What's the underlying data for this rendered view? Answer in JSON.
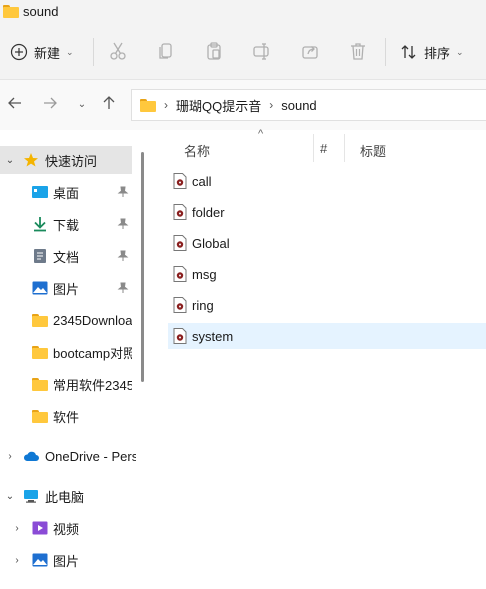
{
  "window": {
    "title": "sound"
  },
  "toolbar": {
    "new_label": "新建",
    "sort_label": "排序",
    "icons": [
      "cut-icon",
      "copy-icon",
      "paste-icon",
      "rename-icon",
      "share-icon",
      "delete-icon"
    ]
  },
  "address": {
    "crumbs": [
      "珊瑚QQ提示音",
      "sound"
    ]
  },
  "nav": {
    "quick_access": "快速访问",
    "items": [
      {
        "label": "桌面",
        "icon": "desktop-icon",
        "pinned": true
      },
      {
        "label": "下载",
        "icon": "download-icon",
        "pinned": true
      },
      {
        "label": "文档",
        "icon": "document-icon",
        "pinned": true
      },
      {
        "label": "图片",
        "icon": "pictures-icon",
        "pinned": true
      },
      {
        "label": "2345Downloa",
        "icon": "folder-icon",
        "pinned": false
      },
      {
        "label": "bootcamp对照",
        "icon": "folder-icon",
        "pinned": false
      },
      {
        "label": "常用软件2345",
        "icon": "folder-icon",
        "pinned": false
      },
      {
        "label": "软件",
        "icon": "folder-icon",
        "pinned": false
      }
    ],
    "onedrive": "OneDrive - Pers",
    "this_pc": "此电脑",
    "pc_items": [
      {
        "label": "视频",
        "icon": "video-icon"
      },
      {
        "label": "图片",
        "icon": "pictures-icon"
      }
    ]
  },
  "columns": {
    "name": "名称",
    "number": "#",
    "title": "标题"
  },
  "files": [
    {
      "name": "call"
    },
    {
      "name": "folder"
    },
    {
      "name": "Global"
    },
    {
      "name": "msg"
    },
    {
      "name": "ring"
    },
    {
      "name": "system"
    }
  ],
  "colors": {
    "accent": "#0067c0",
    "hover_row": "#e5f3ff",
    "folder": "#ffc83d"
  }
}
